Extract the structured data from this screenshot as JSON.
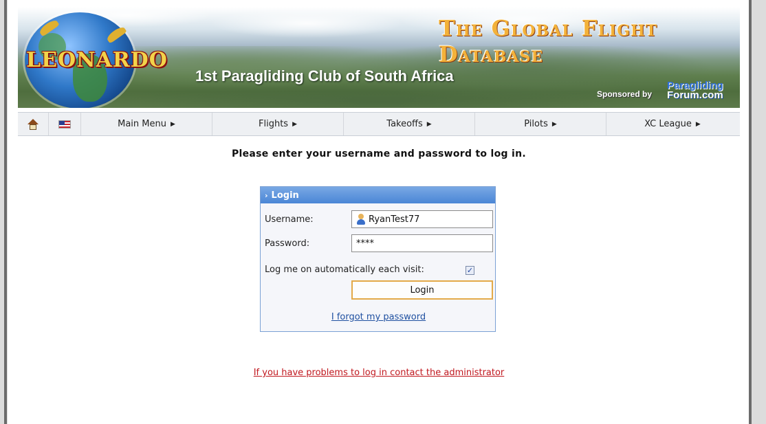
{
  "banner": {
    "logo_text": "LEONARDO",
    "site_title": "The Global Flight Database",
    "club_name": "1st Paragliding Club of South Africa",
    "sponsor_label": "Sponsored by",
    "sponsor_line1": "Paragliding",
    "sponsor_line2": "Forum.com"
  },
  "nav": {
    "items": [
      {
        "label": "Main Menu",
        "arrow": "▶"
      },
      {
        "label": "Flights",
        "arrow": "▶"
      },
      {
        "label": "Takeoffs",
        "arrow": "▶"
      },
      {
        "label": "Pilots",
        "arrow": "▶"
      },
      {
        "label": "XC League",
        "arrow": "▶"
      }
    ]
  },
  "page": {
    "prompt": "Please enter your username and password to log in."
  },
  "login": {
    "header": "Login",
    "username_label": "Username:",
    "username_value": "RyanTest77",
    "password_label": "Password:",
    "password_value": "****",
    "remember_label": "Log me on automatically each visit:",
    "remember_checked": true,
    "check_mark": "✓",
    "button_label": "Login",
    "forgot_link": "I forgot my password"
  },
  "footer": {
    "problems_link": "If you have problems to log in contact the administrator"
  },
  "colors": {
    "accent_header": "#4a86d6",
    "button_border": "#e3a948",
    "link": "#1e4fa0",
    "error_link": "#c0171e"
  }
}
